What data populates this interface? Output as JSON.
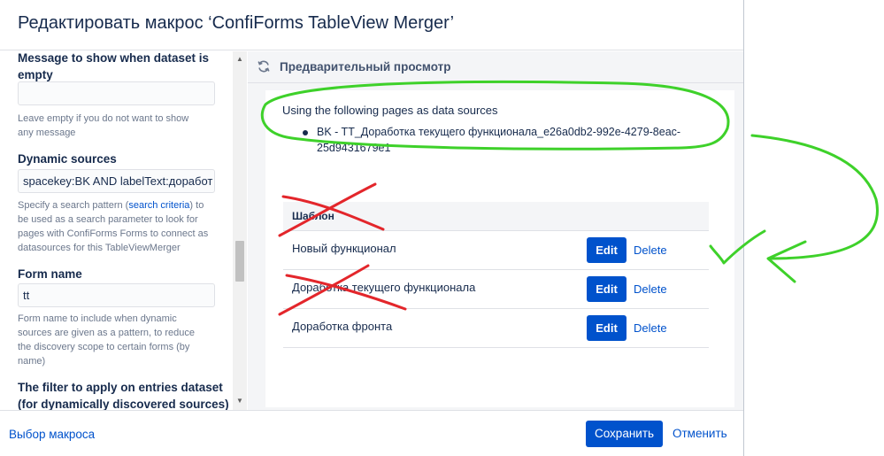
{
  "dialog": {
    "title": "Редактировать макрос ‘ConfiForms TableView Merger’"
  },
  "params": {
    "empty_message": {
      "label_line1": "Message to show when dataset is",
      "label_line2": "empty",
      "value": "",
      "help_line1": "Leave empty if you do not want to show",
      "help_line2": "any message"
    },
    "dynamic_sources": {
      "label": "Dynamic sources",
      "value": "spacekey:BK AND labelText:доработ",
      "help_pre": "Specify a search pattern (",
      "help_link": "search criteria",
      "help_post": ") to",
      "help_line2": "be used as a search parameter to look for",
      "help_line3": "pages with ConfiForms Forms to connect as",
      "help_line4": "datasources for this TableViewMerger"
    },
    "form_name": {
      "label": "Form name",
      "value": "tt",
      "help_line1": "Form name to include when dynamic",
      "help_line2": "sources are given as a pattern, to reduce",
      "help_line3": "the discovery scope to certain forms (by",
      "help_line4": "name)"
    },
    "filter": {
      "label_line1": "The filter to apply on entries dataset",
      "label_line2": "(for dynamically discovered sources)"
    }
  },
  "preview": {
    "title": "Предварительный просмотр",
    "ds_heading": "Using the following pages as data sources",
    "ds_item_line1": "BK - TT_Доработка текущего функционала_e26a0db2-992e-4279-8eac-",
    "ds_item_line2": "25d9431679e1",
    "table_header": "Шаблон",
    "rows": [
      {
        "name": "Новый функционал",
        "edit": "Edit",
        "delete": "Delete"
      },
      {
        "name": "Доработка текущего функционала",
        "edit": "Edit",
        "delete": "Delete"
      },
      {
        "name": "Доработка фронта",
        "edit": "Edit",
        "delete": "Delete"
      }
    ]
  },
  "footer": {
    "back": "Выбор макроса",
    "save": "Сохранить",
    "cancel": "Отменить"
  },
  "colors": {
    "primary": "#0052cc",
    "annotation_green": "#3ed12a",
    "annotation_red": "#e3262b"
  },
  "icons": {
    "refresh": "refresh-icon"
  }
}
